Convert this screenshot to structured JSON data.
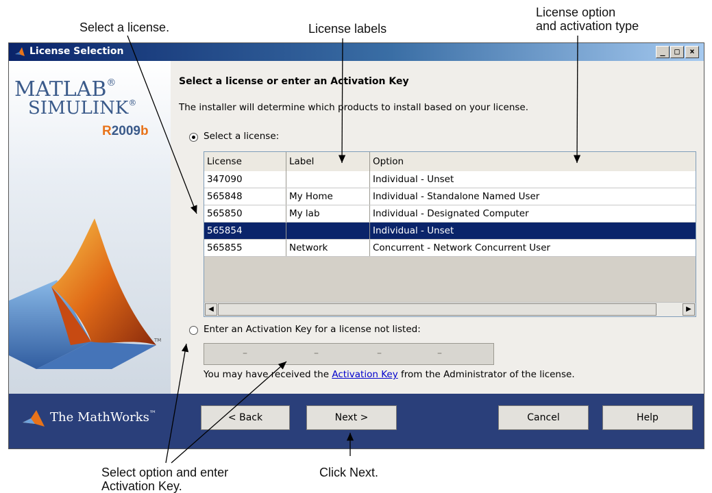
{
  "callouts": {
    "select_license": "Select a license.",
    "license_labels": "License labels",
    "license_option_line1": "License option",
    "license_option_line2": "and activation type",
    "select_option_line1": "Select option and enter",
    "select_option_line2": "Activation Key.",
    "click_next": "Click Next."
  },
  "window": {
    "title": "License Selection",
    "controls": [
      "_",
      "□",
      "×"
    ]
  },
  "branding": {
    "matlab": "MATLAB",
    "simulink": "SIMULINK",
    "registered": "®",
    "release_r": "R",
    "release_year": "2009",
    "release_b": "b",
    "tm": "TM",
    "mathworks": "The MathWorks",
    "mathworks_tm": "™"
  },
  "main": {
    "heading": "Select a license or enter an Activation Key",
    "description": "The installer will determine which products to install based on your license.",
    "radio_select_label": "Select a license:",
    "radio_enter_label": "Enter an Activation Key for a license not listed:",
    "key_placeholder_dashes": [
      "–",
      "–",
      "–",
      "–"
    ],
    "hint_before": "You may have received the ",
    "hint_link": "Activation Key",
    "hint_after": " from the Administrator of the license."
  },
  "table": {
    "columns": [
      "License",
      "Label",
      "Option"
    ],
    "rows": [
      {
        "license": "347090",
        "label": "",
        "option": "Individual - Unset",
        "selected": false
      },
      {
        "license": "565848",
        "label": "My Home",
        "option": "Individual - Standalone Named User",
        "selected": false
      },
      {
        "license": "565850",
        "label": "My lab",
        "option": "Individual - Designated Computer",
        "selected": false
      },
      {
        "license": "565854",
        "label": "",
        "option": "Individual - Unset",
        "selected": true
      },
      {
        "license": "565855",
        "label": "Network",
        "option": "Concurrent - Network Concurrent User",
        "selected": false
      }
    ]
  },
  "footer": {
    "back": "< Back",
    "next": "Next >",
    "cancel": "Cancel",
    "help": "Help"
  },
  "colors": {
    "footer_bg": "#2a3f7a",
    "selection": "#0a246a",
    "link": "#0000cc"
  }
}
